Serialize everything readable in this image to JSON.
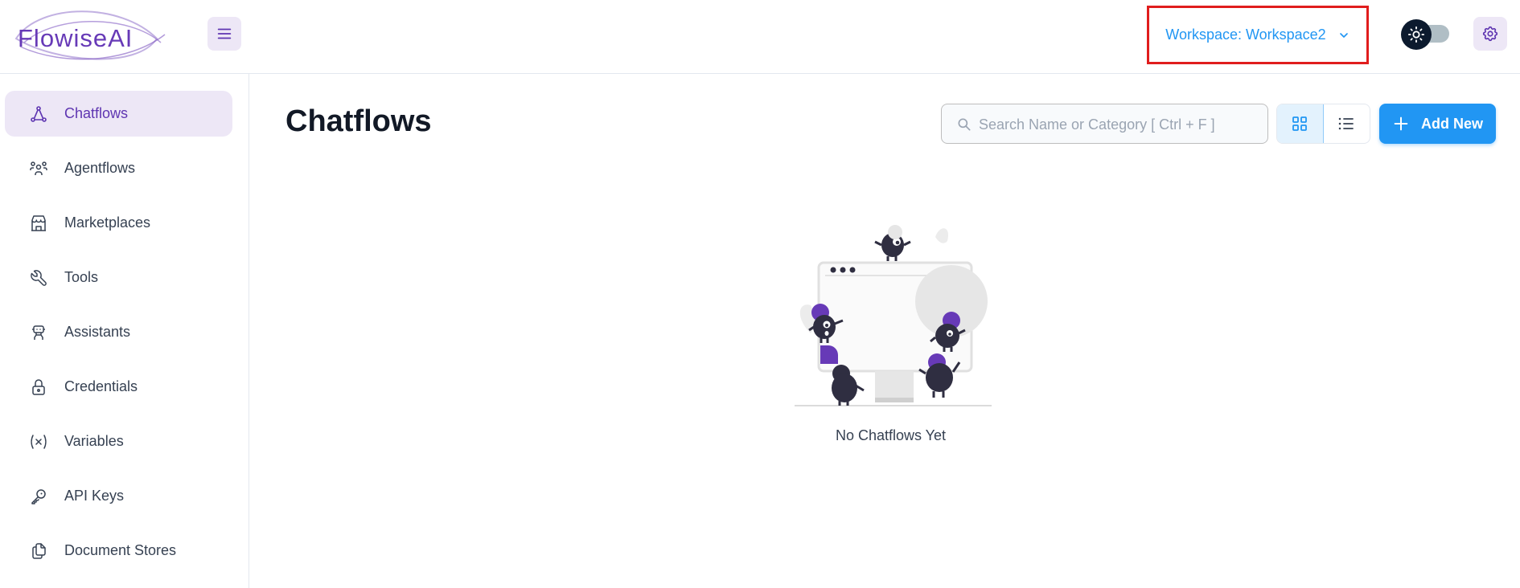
{
  "app": {
    "logo_text": "FlowiseAI"
  },
  "header": {
    "workspace_label": "Workspace: Workspace2"
  },
  "sidebar": {
    "items": [
      {
        "label": "Chatflows",
        "icon": "hierarchy-icon",
        "active": true
      },
      {
        "label": "Agentflows",
        "icon": "users-group-icon",
        "active": false
      },
      {
        "label": "Marketplaces",
        "icon": "building-store-icon",
        "active": false
      },
      {
        "label": "Tools",
        "icon": "tool-icon",
        "active": false
      },
      {
        "label": "Assistants",
        "icon": "robot-icon",
        "active": false
      },
      {
        "label": "Credentials",
        "icon": "lock-icon",
        "active": false
      },
      {
        "label": "Variables",
        "icon": "variable-icon",
        "active": false
      },
      {
        "label": "API Keys",
        "icon": "key-icon",
        "active": false
      },
      {
        "label": "Document Stores",
        "icon": "files-icon",
        "active": false
      }
    ]
  },
  "main": {
    "title": "Chatflows",
    "search": {
      "placeholder": "Search Name or Category [ Ctrl + F ]",
      "value": ""
    },
    "add_button_label": "Add New",
    "empty_message": "No Chatflows Yet"
  },
  "colors": {
    "accent_purple": "#673ab7",
    "accent_blue": "#2196f3",
    "highlight_border": "#e01d1d",
    "active_bg": "#ede7f6"
  }
}
